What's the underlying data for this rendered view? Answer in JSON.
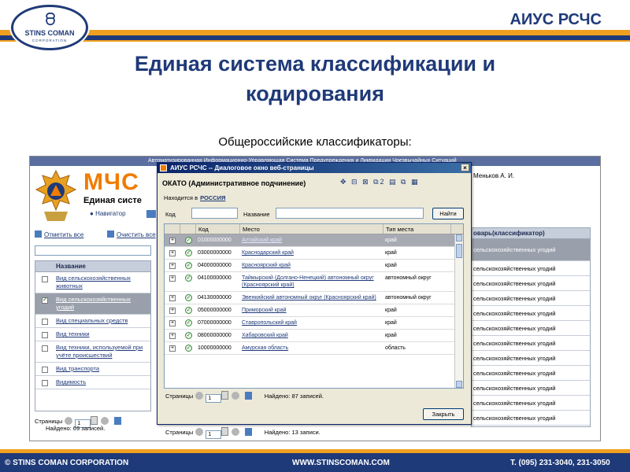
{
  "slide": {
    "brand": "АИУС РСЧС",
    "logo_name": "STINS COMAN",
    "logo_sub": "CORPORATION",
    "title_line1": "Единая система классификации и",
    "title_line2": "кодирования",
    "subtitle": "Общероссийские классификаторы:"
  },
  "app": {
    "bar_text": "Автоматизированная Информационно-Управляющая Система Предупреждения и Ликвидации Чрезвычайных Ситуаций",
    "org": "МЧС",
    "system": "Единая систе",
    "navigator": "Навигатор",
    "user": "Меньков А. И.",
    "select_all": "Отметить все",
    "clear_all": "Очистить все",
    "left_grid": {
      "header": "Название",
      "rows": [
        {
          "label": "Вид сельскохозяйственных животных",
          "checked": false,
          "selected": false
        },
        {
          "label": "Вид сельскохозяйственных угодий",
          "checked": true,
          "selected": true
        },
        {
          "label": "Вид специальных средств",
          "checked": false,
          "selected": false
        },
        {
          "label": "Вид техники",
          "checked": false,
          "selected": false
        },
        {
          "label": "Вид техники, используемой при учёте происшествий",
          "checked": false,
          "selected": false
        },
        {
          "label": "Вид транспорта",
          "checked": false,
          "selected": false
        },
        {
          "label": "Видимость",
          "checked": false,
          "selected": false
        }
      ]
    },
    "left_pager": {
      "label": "Страницы",
      "page": "1",
      "found": "Найдено: 69 записей."
    },
    "right_grid": {
      "header": "оварь(классификатор)",
      "rows": [
        "сельскохозяйственных угодий",
        "сельскохозяйственных угодий",
        "сельскохозяйственных угодий",
        "сельскохозяйственных угодий",
        "сельскохозяйственных угодий",
        "сельскохозяйственных угодий",
        "сельскохозяйственных угодий",
        "сельскохозяйственных угодий",
        "сельскохозяйственных угодий",
        "сельскохозяйственных угодий",
        "сельскохозяйственных угодий",
        "сельскохозяйственных угодий"
      ]
    },
    "bottom_pager": {
      "label": "Страницы",
      "page": "1",
      "found": "Найдено: 13 записи."
    }
  },
  "dialog": {
    "title": "АИУС РСЧС -- Диалоговое окно веб-страницы",
    "close": "×",
    "heading": "ОКАТО (Административное подчинение)",
    "tools": "✥ ⊟ ⊠ ⧉2 ▤ ⧉ ▦",
    "located_label": "Находится в",
    "located_value": "РОССИЯ",
    "code_label": "Код",
    "name_label": "Название",
    "find_button": "Найти",
    "columns": {
      "code": "Код",
      "place": "Место",
      "type": "Тип места"
    },
    "rows": [
      {
        "code": "01000000000",
        "place": "Алтайский край",
        "type": "край",
        "selected": true
      },
      {
        "code": "03000000000",
        "place": "Краснодарский край",
        "type": "край",
        "selected": false
      },
      {
        "code": "04000000000",
        "place": "Красноярский край",
        "type": "край",
        "selected": false
      },
      {
        "code": "04100000000",
        "place": "Таймырский (Долгано-Ненецкий) автономный округ (Красноярский край)",
        "type": "автономный округ",
        "selected": false
      },
      {
        "code": "04130000000",
        "place": "Эвенкийский автономный округ (Красноярский край)",
        "type": "автономный округ",
        "selected": false
      },
      {
        "code": "05000000000",
        "place": "Приморский край",
        "type": "край",
        "selected": false
      },
      {
        "code": "07000000000",
        "place": "Ставропольский край",
        "type": "край",
        "selected": false
      },
      {
        "code": "08000000000",
        "place": "Хабаровский край",
        "type": "край",
        "selected": false
      },
      {
        "code": "10000000000",
        "place": "Амурская область",
        "type": "область",
        "selected": false
      }
    ],
    "pager": {
      "label": "Страницы",
      "page": "1",
      "found": "Найдено: 87 записей."
    },
    "close_button": "Закрыть"
  },
  "footer": {
    "left": "© STINS COMAN CORPORATION",
    "center": "WWW.STINSCOMAN.COM",
    "right": "Т. (095) 231-3040, 231-3050"
  },
  "colors": {
    "navy": "#1f3a78",
    "orange": "#f0a020",
    "mchs_orange": "#f07c00"
  }
}
